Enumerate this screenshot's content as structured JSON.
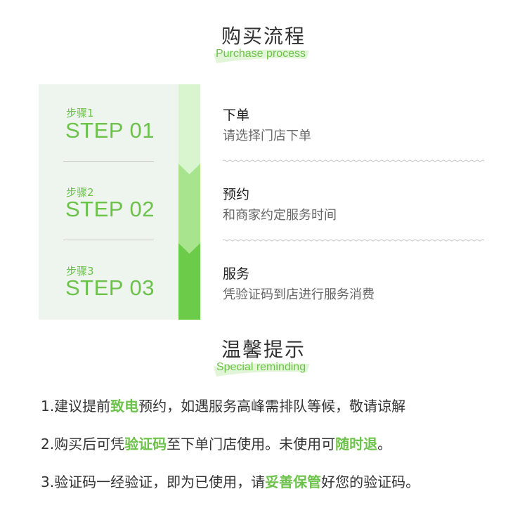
{
  "purchase": {
    "title": "购买流程",
    "subtitle": "Purchase process"
  },
  "steps": [
    {
      "cn": "步骤1",
      "en": "STEP 01",
      "title": "下单",
      "desc": "请选择门店下单"
    },
    {
      "cn": "步骤2",
      "en": "STEP 02",
      "title": "预约",
      "desc": "和商家约定服务时间"
    },
    {
      "cn": "步骤3",
      "en": "STEP 03",
      "title": "服务",
      "desc": "凭验证码到店进行服务消费"
    }
  ],
  "reminder": {
    "title": "温馨提示",
    "subtitle": "Special reminding",
    "tips": [
      {
        "pre": "1.建议提前",
        "hl": "致电",
        "post": "预约，如遇服务高峰需排队等候，敬请谅解"
      },
      {
        "pre": "2.购买后可凭",
        "hl": "验证码",
        "post": "至下单门店使用。未使用可",
        "hl2": "随时退",
        "post2": "。"
      },
      {
        "pre": "3.验证码一经验证，即为已使用，请",
        "hl": "妥善保管",
        "post": "好您的验证码。"
      }
    ]
  },
  "colors": {
    "accent": "#6cc24a",
    "bar1": "#d8f5d0",
    "bar2": "#a8e48e",
    "bar3": "#6ccb48",
    "panel": "#eef5ee"
  }
}
